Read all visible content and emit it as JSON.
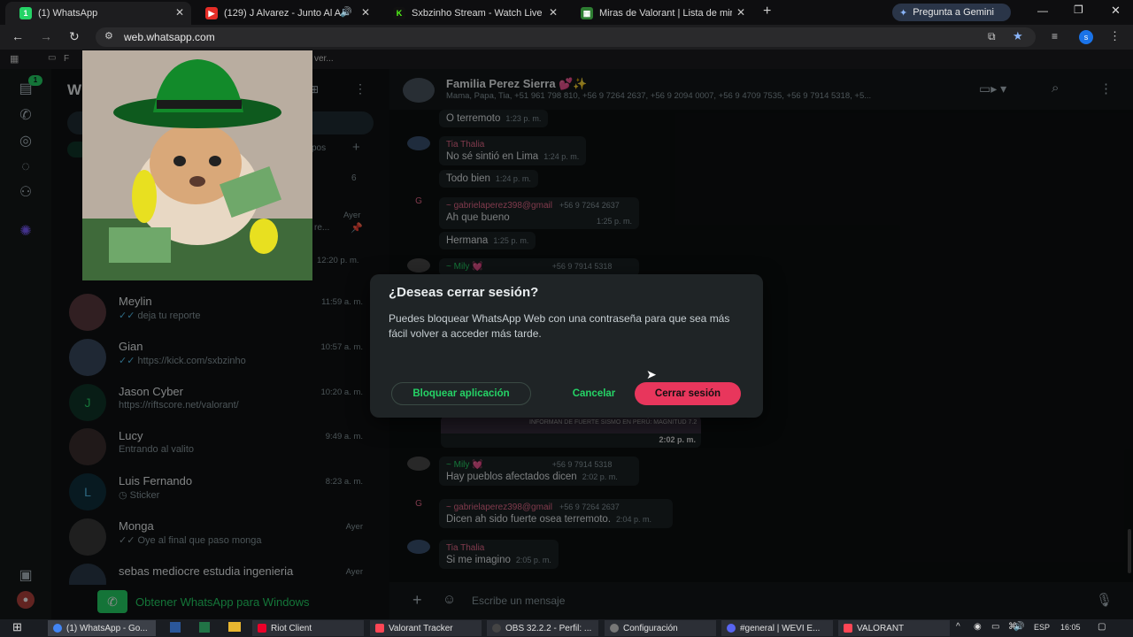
{
  "tabs": [
    {
      "title": "(1) WhatsApp",
      "color": "#25d366",
      "glyph": "1"
    },
    {
      "title": "(129) J Alvarez - Junto Al A",
      "color": "#e52d27",
      "glyph": "▶"
    },
    {
      "title": "Sxbzinho Stream - Watch Live o",
      "color": "#53fc18",
      "glyph": "K"
    },
    {
      "title": "Miras de Valorant | Lista de mir",
      "color": "#2e7d32",
      "glyph": "▦"
    }
  ],
  "gemini": "Pregunta a Gemini",
  "url": "web.whatsapp.com",
  "profile_initial": "s",
  "bookmarks": {
    "folder": "F",
    "more": "ver..."
  },
  "sidebar": {
    "unread_badge": "1",
    "filter_count": "6",
    "tab_fragment": "pos",
    "partial_times": [
      "Ayer",
      "12:20 p. m."
    ],
    "chats": [
      {
        "name": "Meylin",
        "msg": "deja tu reporte",
        "time": "11:59 a. m.",
        "check": "✓✓"
      },
      {
        "name": "Gian",
        "msg": "https://kick.com/sxbzinho",
        "time": "10:57 a. m.",
        "check": "✓✓"
      },
      {
        "name": "Jason Cyber",
        "msg": "https://riftscore.net/valorant/",
        "time": "10:20 a. m.",
        "initial": "J"
      },
      {
        "name": "Lucy",
        "msg": "Entrando al valito",
        "time": "9:49 a. m."
      },
      {
        "name": "Luis Fernando",
        "msg": "Sticker",
        "time": "8:23 a. m.",
        "initial": "L"
      },
      {
        "name": "Monga",
        "msg": "Oye al final que paso monga",
        "time": "Ayer",
        "check": "✓✓"
      },
      {
        "name": "sebas mediocre estudia ingenieria",
        "msg": "",
        "time": "Ayer"
      }
    ],
    "get_windows": "Obtener WhatsApp para Windows"
  },
  "chat": {
    "group_name": "Familia Perez Sierra 💕✨",
    "members": "Mama, Papa, Tia, +51 961 798 810, +56 9 7264 2637, +56 9 2094 0007, +56 9 4709 7535, +56 9 7914 5318, +5...",
    "messages": [
      {
        "sender": "",
        "text": "O terremoto",
        "time": "1:23 p. m."
      },
      {
        "sender": "Tia Thalia",
        "text": "No sé sintió en Lima",
        "time": "1:24 p. m."
      },
      {
        "sender": "",
        "text": "Todo bien",
        "time": "1:24 p. m."
      },
      {
        "sender": "~ gabrielaperez398@gmail",
        "phone": "+56 9 7264 2637",
        "text": "Ah que bueno",
        "time": "1:25 p. m."
      },
      {
        "sender": "",
        "text": "Hermana",
        "time": "1:25 p. m."
      },
      {
        "sender": "~ Mily 💓",
        "phone": "+56 9 7914 5318",
        "text": "",
        "time": ""
      },
      {
        "sender": "",
        "text": "",
        "time": "2:02 p. m.",
        "media_caption": "INFORMAN DE FUERTE SISMO EN PERÚ: MAGNITUD 7.2"
      },
      {
        "sender": "~ Mily 💓",
        "phone": "+56 9 7914 5318",
        "text": "Hay pueblos afectados dicen",
        "time": "2:02 p. m."
      },
      {
        "sender": "~ gabrielaperez398@gmail",
        "phone": "+56 9 7264 2637",
        "text": "Dicen ah sido fuerte osea terremoto.",
        "time": "2:04 p. m."
      },
      {
        "sender": "Tia Thalia",
        "text": "Si me imagino",
        "time": "2:05 p. m."
      }
    ],
    "composer_placeholder": "Escribe un mensaje"
  },
  "dialog": {
    "title": "¿Deseas cerrar sesión?",
    "body": "Puedes bloquear WhatsApp Web con una contraseña para que sea más fácil volver a acceder más tarde.",
    "lock_label": "Bloquear aplicación",
    "cancel_label": "Cancelar",
    "logout_label": "Cerrar sesión"
  },
  "taskbar": {
    "items": [
      {
        "label": "(1) WhatsApp - Go...",
        "color": "#4285f4"
      },
      {
        "label": "Riot Client",
        "color": "#eb0029"
      },
      {
        "label": "Valorant Tracker",
        "color": "#ff4655"
      },
      {
        "label": "OBS 32.2.2 - Perfil: ...",
        "color": "#333333"
      },
      {
        "label": "Configuración",
        "color": "#777777"
      },
      {
        "label": "#general | WEVI E...",
        "color": "#5865f2"
      },
      {
        "label": "VALORANT",
        "color": "#ff4655"
      }
    ],
    "lang": "ESP",
    "clock": "16:05"
  },
  "colors": {
    "accent": "#25d366",
    "danger": "#e8365c",
    "tia": "#e86a8a",
    "gabriela": "#e86a8a",
    "mily": "#25d366"
  }
}
